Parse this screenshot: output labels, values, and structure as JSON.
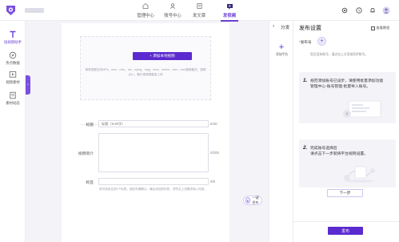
{
  "colors": {
    "accent": "#5b2bcf",
    "accent_light": "#ede9f9",
    "background": "#f4f3f8"
  },
  "topnav": {
    "items": [
      {
        "label": "管理中心",
        "icon": "home-icon",
        "active": false
      },
      {
        "label": "账号中心",
        "icon": "user-icon",
        "active": false
      },
      {
        "label": "发文章",
        "icon": "article-icon",
        "active": false
      },
      {
        "label": "发视频",
        "icon": "video-icon",
        "active": true
      }
    ],
    "right_icons": [
      "settings-icon",
      "help-icon",
      "bell-icon",
      "avatar"
    ]
  },
  "sidebar": {
    "items": [
      {
        "label": "短视频助手",
        "icon": "text-t-icon",
        "active": true
      },
      {
        "label": "热点数据",
        "icon": "compass-icon",
        "active": false
      },
      {
        "label": "视频素材",
        "icon": "media-icon",
        "active": false
      },
      {
        "label": "素材动态",
        "icon": "doc-icon",
        "active": false
      }
    ]
  },
  "upload": {
    "button_label": "+ 添加本地视频",
    "hint_line1": "单条视频支持MP4、mov、m4v、avi、mpeg、mpg、wmv、webm、mkv、mxd视频格式，视频",
    "hint_line2": "大小，最长视频请直接上传"
  },
  "form": {
    "title_label": "标题",
    "title_placeholder": "标题（5-30字）",
    "title_count": "0/30",
    "desc_label": "视频简介",
    "desc_count": "0/200",
    "tag_label": "标签",
    "tag_count": "0/5",
    "tag_hint": "您可添加至多5个标签，按回车键确认，最后添加的标签，须符合上述要求填入完成。"
  },
  "onekey": {
    "label": "一键发布"
  },
  "strip": {
    "title": "分发",
    "add_label": "添加平台"
  },
  "publish_settings": {
    "title": "发布设置",
    "help_label": "查看教程",
    "account_label": "发布号",
    "account_hint": "您还没有账号，请点击上方添加同步帐号。",
    "step1_num": "1.",
    "step1_text_a": "规范添加账号已设步，请使用批量添加功能",
    "step1_text_b": "管理中心-账号管理-批量导入账号。",
    "step2_num": "2.",
    "step2_text_a": "完成账号选择后",
    "step2_text_b": "请点击下一步就将平台规则设置。",
    "next_label": "下一步",
    "publish_label": "发布"
  }
}
